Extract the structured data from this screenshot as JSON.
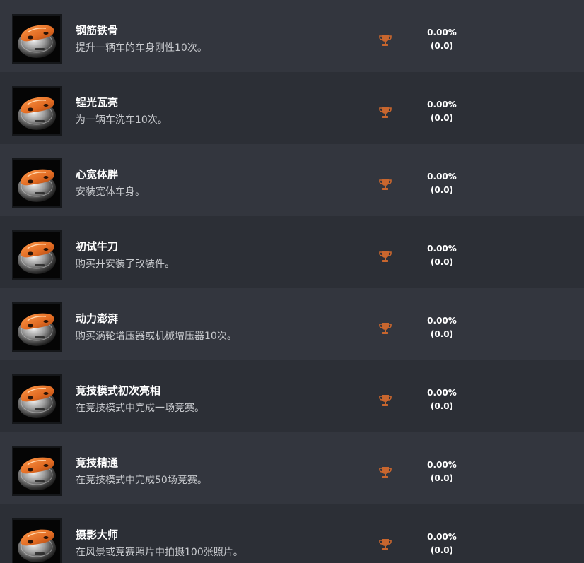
{
  "achievements": [
    {
      "title": "钢筋铁骨",
      "desc": "提升一辆车的车身刚性10次。",
      "percent": "0.00%",
      "points": "(0.0)"
    },
    {
      "title": "锃光瓦亮",
      "desc": "为一辆车洗车10次。",
      "percent": "0.00%",
      "points": "(0.0)"
    },
    {
      "title": "心宽体胖",
      "desc": "安装宽体车身。",
      "percent": "0.00%",
      "points": "(0.0)"
    },
    {
      "title": "初试牛刀",
      "desc": "购买并安装了改装件。",
      "percent": "0.00%",
      "points": "(0.0)"
    },
    {
      "title": "动力澎湃",
      "desc": "购买涡轮增压器或机械增压器10次。",
      "percent": "0.00%",
      "points": "(0.0)"
    },
    {
      "title": "竞技模式初次亮相",
      "desc": "在竞技模式中完成一场竞赛。",
      "percent": "0.00%",
      "points": "(0.0)"
    },
    {
      "title": "竞技精通",
      "desc": "在竞技模式中完成50场竞赛。",
      "percent": "0.00%",
      "points": "(0.0)"
    },
    {
      "title": "摄影大师",
      "desc": "在风景或竞赛照片中拍摄100张照片。",
      "percent": "0.00%",
      "points": "(0.0)"
    }
  ],
  "colors": {
    "trophy": "#c8662e",
    "car_orange": "#e06a22",
    "row_light": "#33363e",
    "row_dark": "#2c2f36"
  },
  "icons": {
    "achievement": "car-badge-icon",
    "trophy": "trophy-icon"
  }
}
